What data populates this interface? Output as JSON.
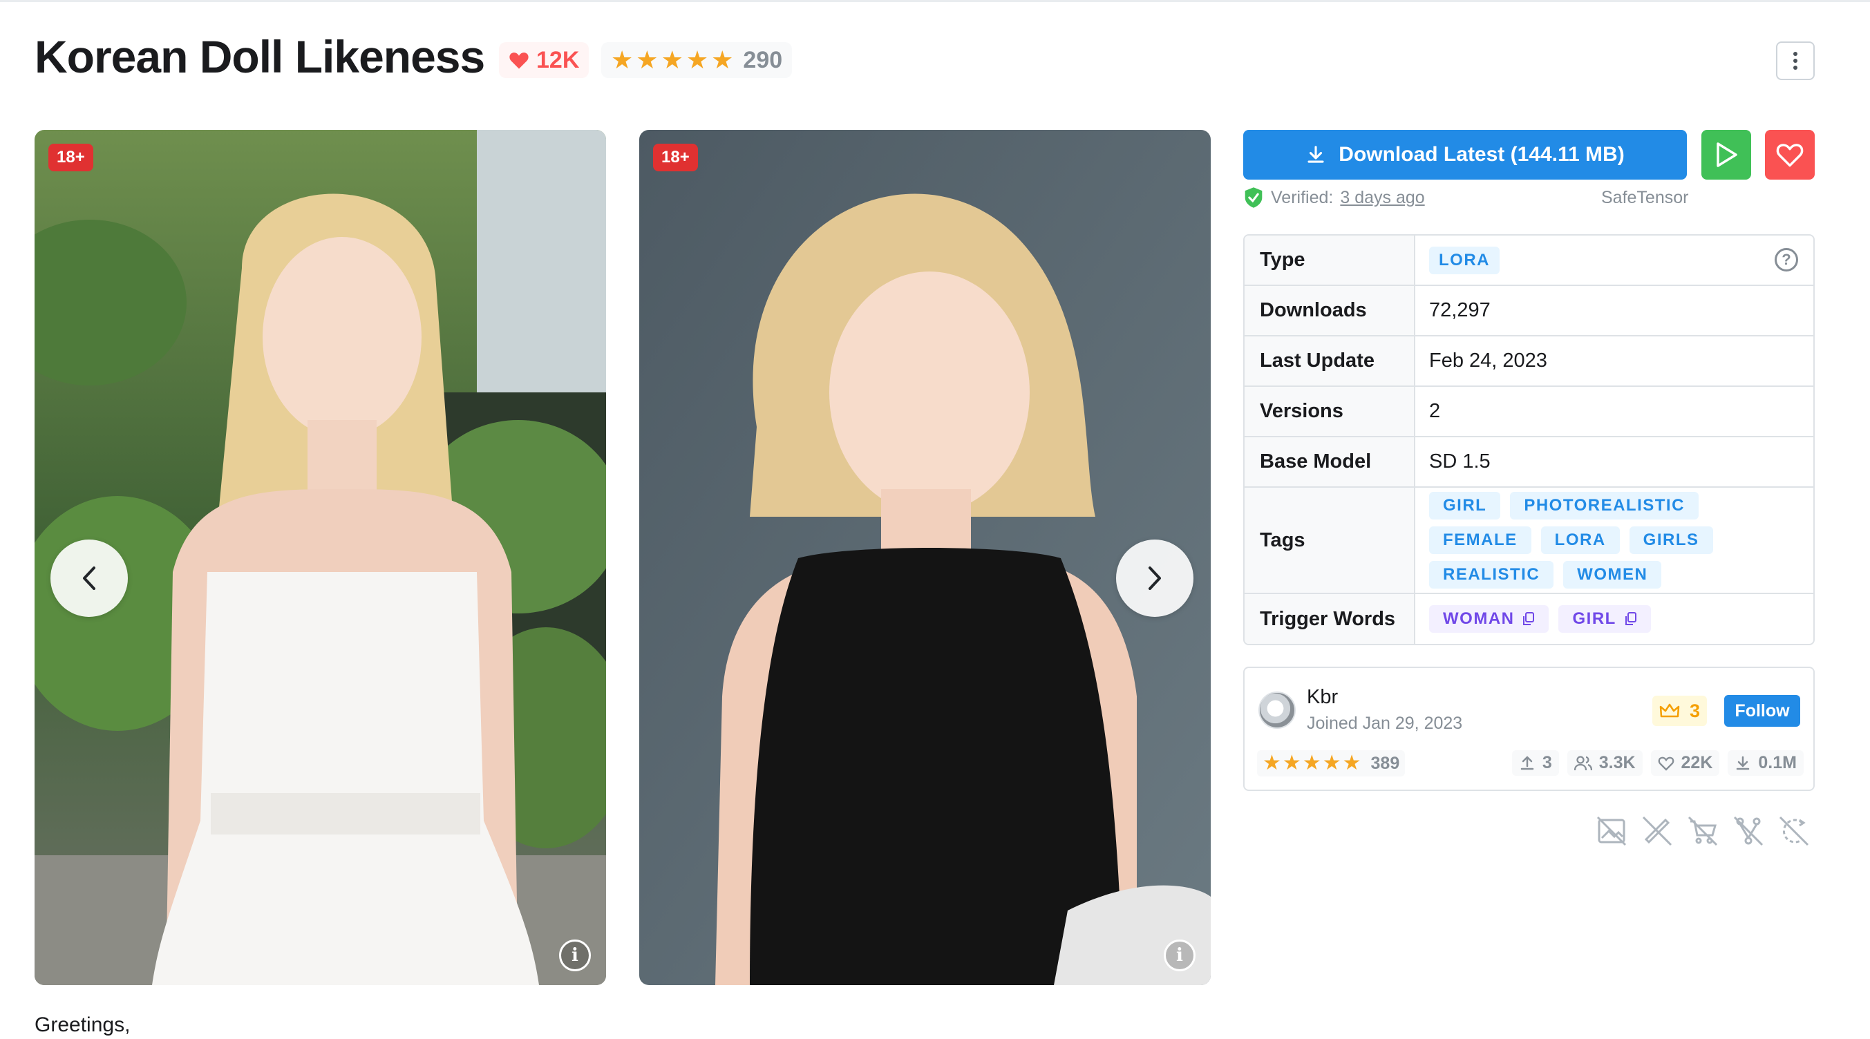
{
  "header": {
    "title": "Korean Doll Likeness",
    "likes": "12K",
    "rating_count": "290",
    "stars": 5
  },
  "gallery": {
    "images": [
      {
        "nsfw_label": "18+"
      },
      {
        "nsfw_label": "18+"
      }
    ]
  },
  "actions": {
    "download_label": "Download Latest (144.11 MB)",
    "verified_label": "Verified:",
    "verified_when": "3 days ago",
    "file_format": "SafeTensor"
  },
  "details": {
    "type_label": "Type",
    "type_value": "LORA",
    "downloads_label": "Downloads",
    "downloads_value": "72,297",
    "last_update_label": "Last Update",
    "last_update_value": "Feb 24, 2023",
    "versions_label": "Versions",
    "versions_value": "2",
    "base_model_label": "Base Model",
    "base_model_value": "SD 1.5",
    "tags_label": "Tags",
    "tags": [
      "GIRL",
      "PHOTOREALISTIC",
      "FEMALE",
      "LORA",
      "GIRLS",
      "REALISTIC",
      "WOMEN"
    ],
    "trigger_label": "Trigger Words",
    "trigger_words": [
      "WOMAN",
      "GIRL"
    ]
  },
  "creator": {
    "name": "Kbr",
    "joined": "Joined Jan 29, 2023",
    "rank": "3",
    "follow_label": "Follow",
    "rating_count": "389",
    "uploads": "3",
    "followers": "3.3K",
    "likes": "22K",
    "downloads": "0.1M"
  },
  "license_icons": [
    "no-images-icon",
    "no-sell-icon",
    "no-commercial-icon",
    "no-merge-icon",
    "no-permission-icon"
  ],
  "description": {
    "first_line": "Greetings,"
  },
  "colors": {
    "accent_blue": "#228be6",
    "run_green": "#40c057",
    "like_red": "#fa5252",
    "star_gold": "#f5a623"
  }
}
